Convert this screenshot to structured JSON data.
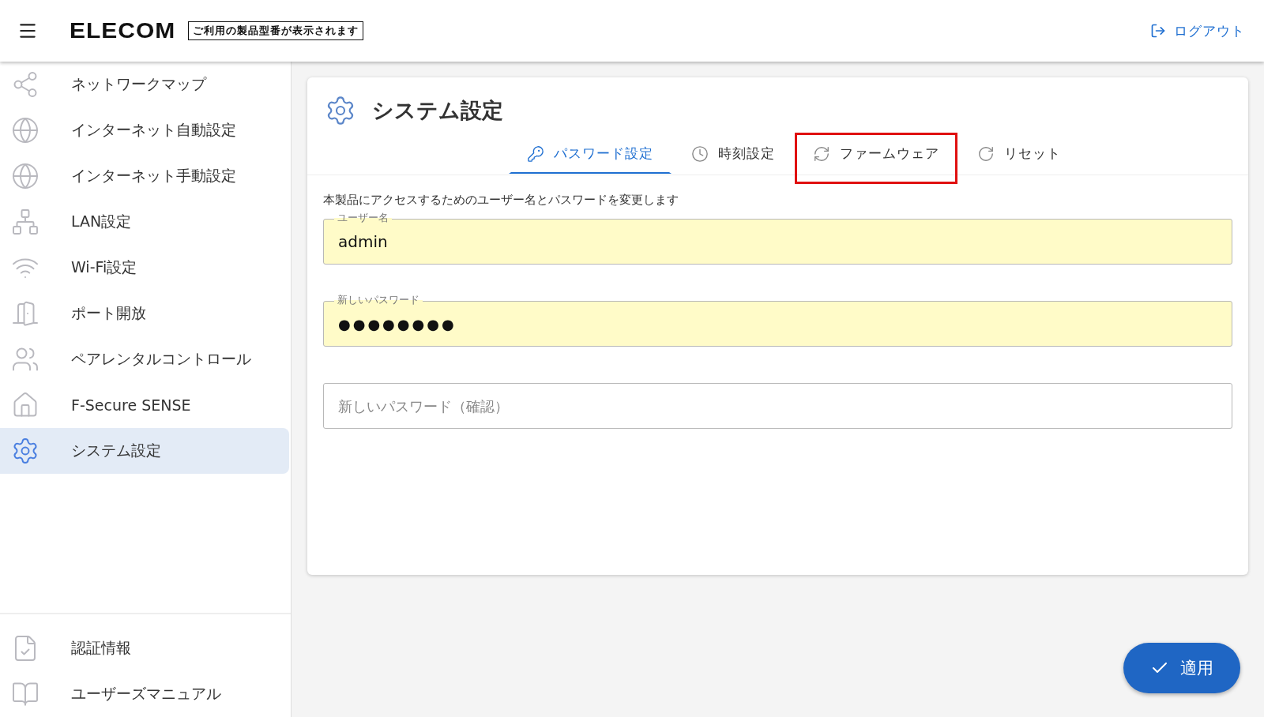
{
  "header": {
    "logo": "ELECOM",
    "model_label": "ご利用の製品型番が表示されます",
    "logout": "ログアウト"
  },
  "sidebar": {
    "items": [
      {
        "label": "ネットワークマップ",
        "selected": false
      },
      {
        "label": "インターネット自動設定",
        "selected": false
      },
      {
        "label": "インターネット手動設定",
        "selected": false
      },
      {
        "label": "LAN設定",
        "selected": false
      },
      {
        "label": "Wi-Fi設定",
        "selected": false
      },
      {
        "label": "ポート開放",
        "selected": false
      },
      {
        "label": "ペアレンタルコントロール",
        "selected": false
      },
      {
        "label": "F-Secure SENSE",
        "selected": false
      },
      {
        "label": "システム設定",
        "selected": true
      }
    ],
    "footer_items": [
      {
        "label": "認証情報"
      },
      {
        "label": "ユーザーズマニュアル"
      }
    ]
  },
  "page": {
    "title": "システム設定",
    "tabs": [
      {
        "label": "パスワード設定",
        "selected": true,
        "highlighted": false
      },
      {
        "label": "時刻設定",
        "selected": false,
        "highlighted": false
      },
      {
        "label": "ファームウェア",
        "selected": false,
        "highlighted": true
      },
      {
        "label": "リセット",
        "selected": false,
        "highlighted": false
      }
    ],
    "description": "本製品にアクセスするためのユーザー名とパスワードを変更します",
    "fields": [
      {
        "label": "ユーザー名",
        "value": "admin",
        "kind": "text"
      },
      {
        "label": "新しいパスワード",
        "value": "●●●●●●●●",
        "kind": "password"
      },
      {
        "placeholder": "新しいパスワード（確認）",
        "kind": "text"
      }
    ]
  },
  "apply_button": "適用"
}
